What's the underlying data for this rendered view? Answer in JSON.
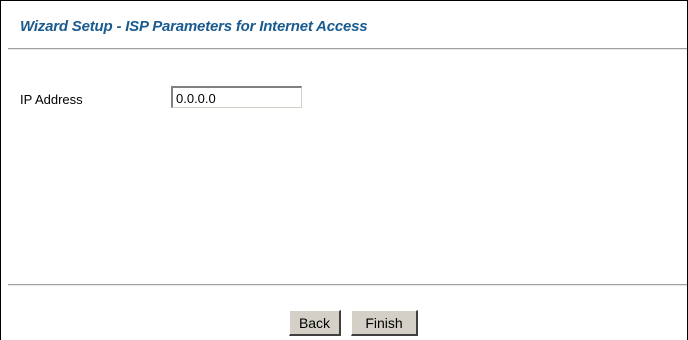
{
  "page": {
    "title": "Wizard Setup - ISP Parameters for Internet Access"
  },
  "form": {
    "ip_address_label": "IP Address",
    "ip_address_value": "0.0.0.0"
  },
  "buttons": {
    "back_label": "Back",
    "finish_label": "Finish"
  },
  "colors": {
    "title": "#1a5b8f",
    "button_face": "#d4d0c8"
  }
}
